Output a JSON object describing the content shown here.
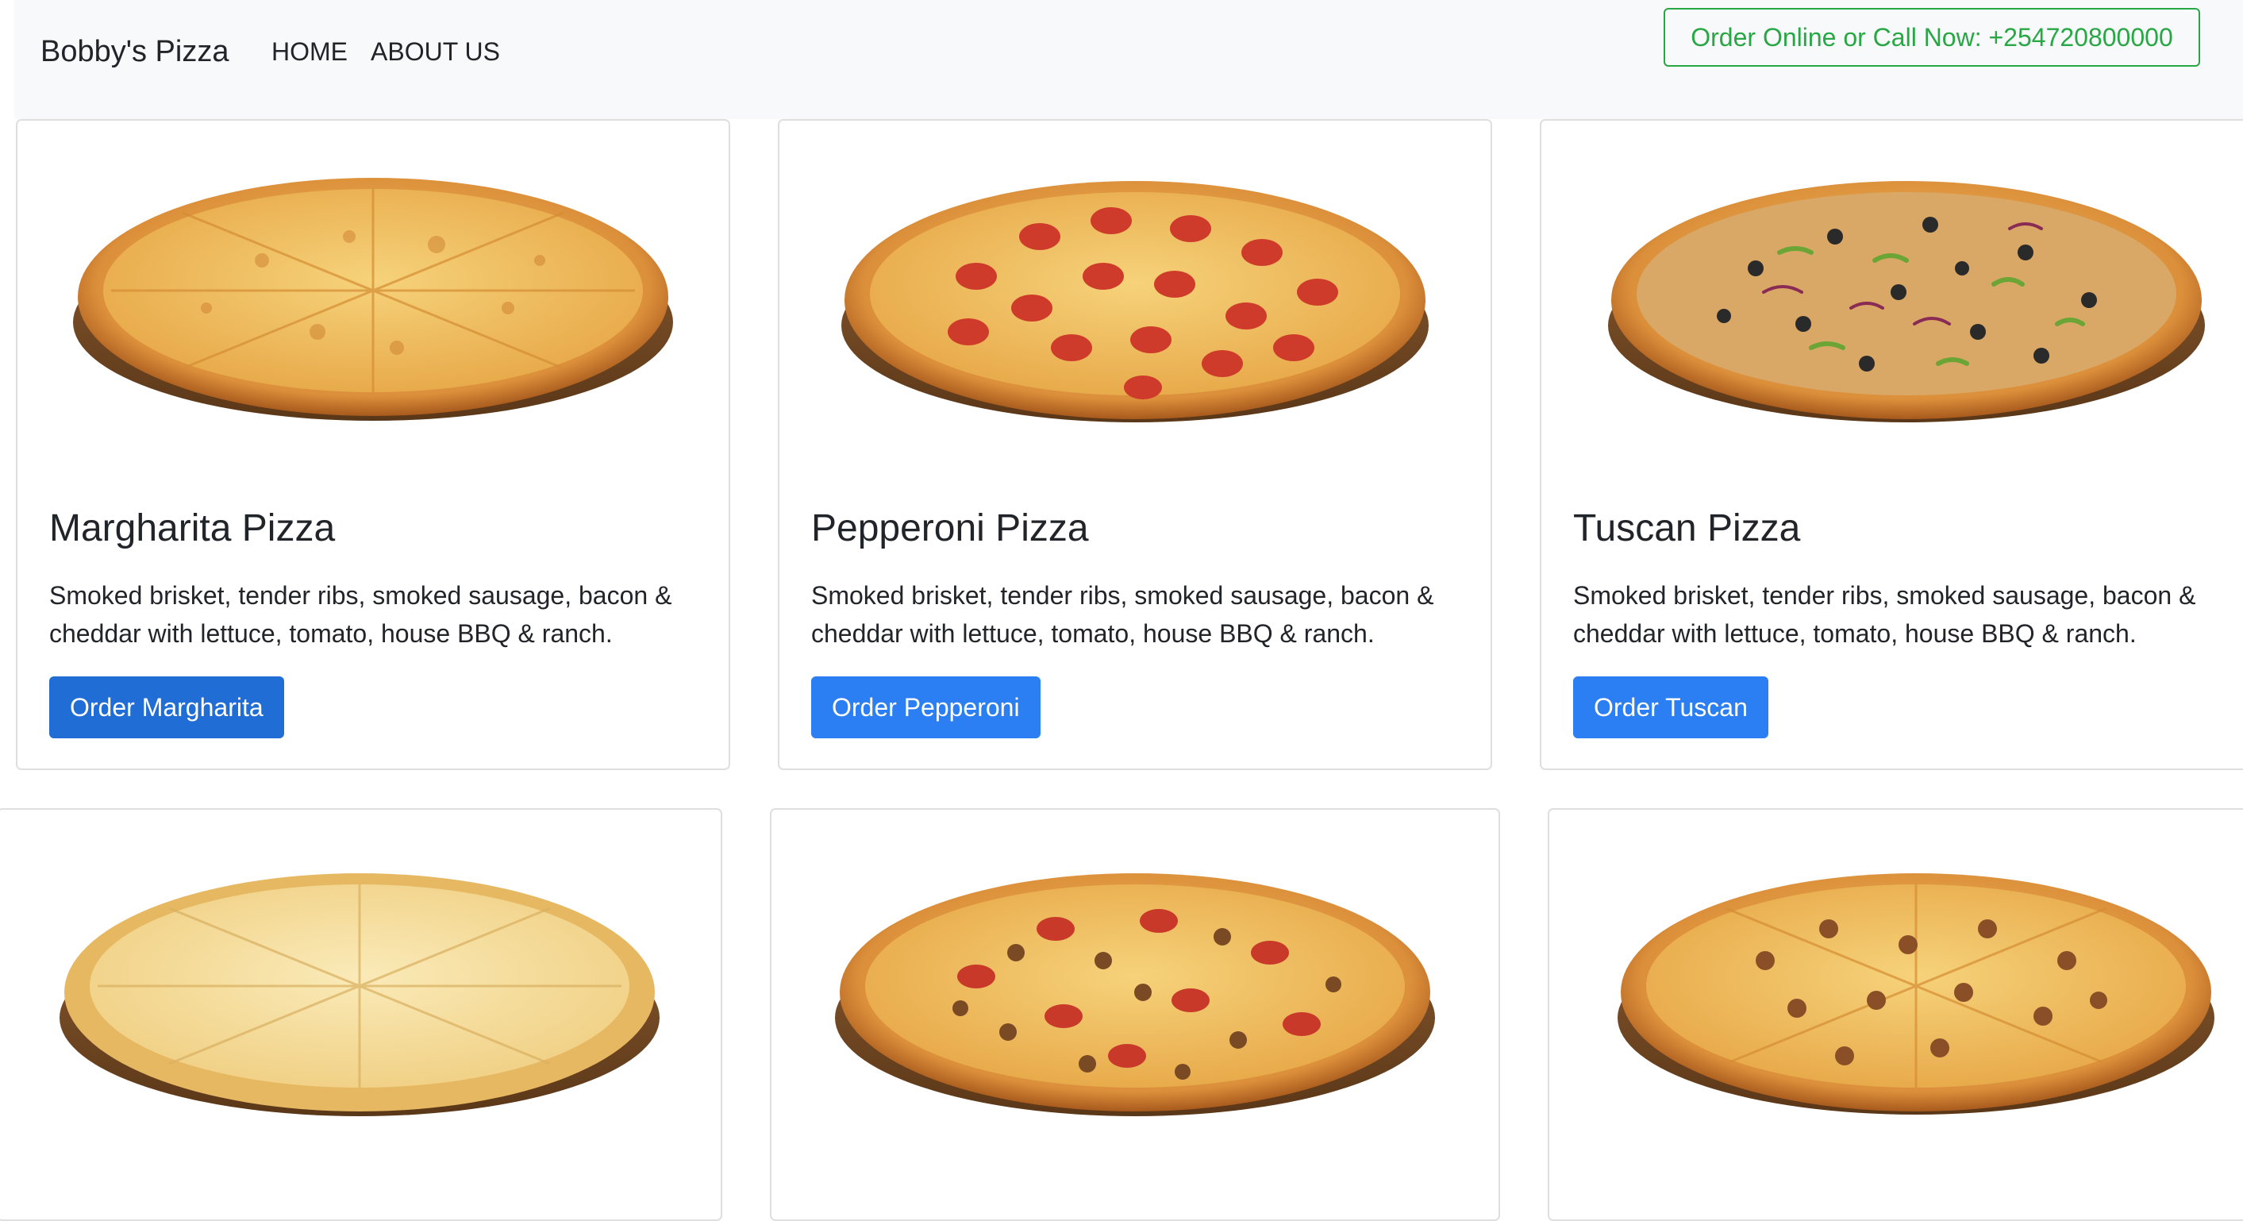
{
  "navbar": {
    "brand": "Bobby's Pizza",
    "links": [
      "HOME",
      "ABOUT US"
    ],
    "call_button": "Order Online or Call Now: +254720800000"
  },
  "menu": {
    "cards": [
      {
        "title": "Margharita Pizza",
        "description": "Smoked brisket, tender ribs, smoked sausage, bacon & cheddar with lettuce, tomato, house BBQ & ranch.",
        "button": "Order Margharita",
        "image": "cheese-pizza"
      },
      {
        "title": "Pepperoni Pizza",
        "description": "Smoked brisket, tender ribs, smoked sausage, bacon & cheddar with lettuce, tomato, house BBQ & ranch.",
        "button": "Order Pepperoni",
        "image": "pepperoni-pizza"
      },
      {
        "title": "Tuscan Pizza",
        "description": "Smoked brisket, tender ribs, smoked sausage, bacon & cheddar with lettuce, tomato, house BBQ & ranch.",
        "button": "Order Tuscan",
        "image": "veggie-pizza"
      },
      {
        "image": "white-cheese-pizza"
      },
      {
        "image": "meat-lovers-pizza"
      },
      {
        "image": "sausage-pizza"
      }
    ]
  },
  "colors": {
    "navbar_bg": "#f8f9fa",
    "call_button_green": "#28a745",
    "order_button_blue": "#2b7ff3"
  }
}
